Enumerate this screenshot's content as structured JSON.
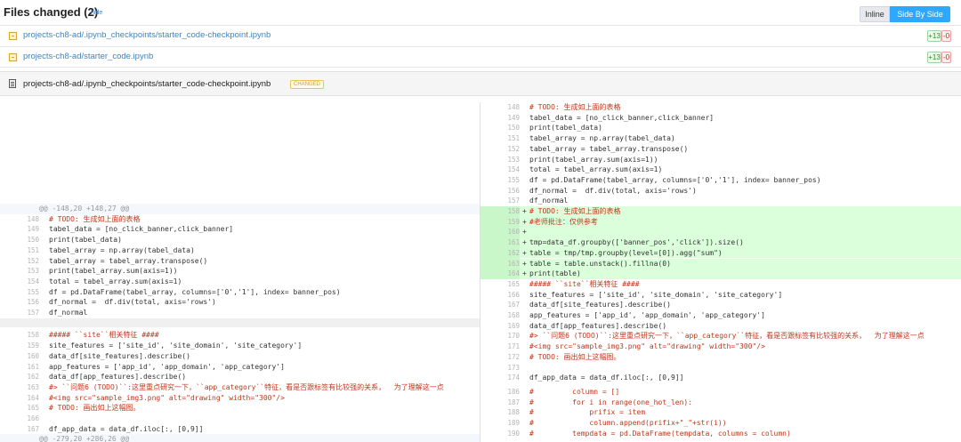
{
  "header": {
    "title": "Files changed (2)",
    "hide": "hide",
    "view_inline": "Inline",
    "view_side_by_side": "Side By Side"
  },
  "files": [
    {
      "path": "projects-ch8-ad/.ipynb_checkpoints/starter_code-checkpoint.ipynb",
      "additions": "+13",
      "deletions": "-0"
    },
    {
      "path": "projects-ch8-ad/starter_code.ipynb",
      "additions": "+13",
      "deletions": "-0"
    }
  ],
  "file_view": {
    "path": "projects-ch8-ad/.ipynb_checkpoints/starter_code-checkpoint.ipynb",
    "badge": "CHANGED",
    "colors": {
      "added_bg": "#dbffdb",
      "accent": "#2ea8ff",
      "link": "#4183c4"
    }
  },
  "left": {
    "hunk1": "@@ -148,20 +148,27 @@",
    "hunk2": "@@ -279,20 +286,26 @@",
    "lines_a": [
      {
        "n": "148",
        "t": "# TODO: 生成如上面的表格"
      },
      {
        "n": "149",
        "t": "tabel_data = [no_click_banner,click_banner]"
      },
      {
        "n": "150",
        "t": "print(tabel_data)"
      },
      {
        "n": "151",
        "t": "tabel_array = np.array(tabel_data)"
      },
      {
        "n": "152",
        "t": "tabel_array = tabel_array.transpose()"
      },
      {
        "n": "153",
        "t": "print(tabel_array.sum(axis=1))"
      },
      {
        "n": "154",
        "t": "total = tabel_array.sum(axis=1)"
      },
      {
        "n": "155",
        "t": "df = pd.DataFrame(tabel_array, columns=['0','1'], index= banner_pos)"
      },
      {
        "n": "156",
        "t": "df_normal =  df.div(total, axis='rows')"
      },
      {
        "n": "157",
        "t": "df_normal"
      }
    ],
    "lines_b": [
      {
        "n": "158",
        "t": "##### ``site``相关特征 ####"
      },
      {
        "n": "159",
        "t": "site_features = ['site_id', 'site_domain', 'site_category']"
      },
      {
        "n": "160",
        "t": "data_df[site_features].describe()"
      },
      {
        "n": "161",
        "t": "app_features = ['app_id', 'app_domain', 'app_category']"
      },
      {
        "n": "162",
        "t": "data_df[app_features].describe()"
      },
      {
        "n": "163",
        "t": "#> ``问题6 (TODO)``:这里重点研究一下，``app_category``特征，看是否跟标签有比较强的关系，  为了理解这一点"
      },
      {
        "n": "164",
        "t": "#<img src=\"sample_img3.png\" alt=\"drawing\" width=\"300\"/>"
      },
      {
        "n": "165",
        "t": "# TODO: 画出如上这幅图。"
      },
      {
        "n": "166",
        "t": ""
      },
      {
        "n": "167",
        "t": "df_app_data = data_df.iloc[:, [0,9]]"
      }
    ]
  },
  "right": {
    "lines": [
      {
        "n": "148",
        "t": "# TODO: 生成如上面的表格",
        "m": ""
      },
      {
        "n": "149",
        "t": "tabel_data = [no_click_banner,click_banner]",
        "m": ""
      },
      {
        "n": "150",
        "t": "print(tabel_data)",
        "m": ""
      },
      {
        "n": "151",
        "t": "tabel_array = np.array(tabel_data)",
        "m": ""
      },
      {
        "n": "152",
        "t": "tabel_array = tabel_array.transpose()",
        "m": ""
      },
      {
        "n": "153",
        "t": "print(tabel_array.sum(axis=1))",
        "m": ""
      },
      {
        "n": "154",
        "t": "total = tabel_array.sum(axis=1)",
        "m": ""
      },
      {
        "n": "155",
        "t": "df = pd.DataFrame(tabel_array, columns=['0','1'], index= banner_pos)",
        "m": ""
      },
      {
        "n": "156",
        "t": "df_normal =  df.div(total, axis='rows')",
        "m": ""
      },
      {
        "n": "157",
        "t": "df_normal",
        "m": ""
      },
      {
        "n": "158",
        "t": "# TODO: 生成如上面的表格",
        "m": "+"
      },
      {
        "n": "159",
        "t": "#老师批注：仅供参考",
        "m": "+"
      },
      {
        "n": "160",
        "t": "",
        "m": "+"
      },
      {
        "n": "161",
        "t": "tmp=data_df.groupby(['banner_pos','click']).size()",
        "m": "+"
      },
      {
        "n": "162",
        "t": "table = tmp/tmp.groupby(level=[0]).agg(\"sum\")",
        "m": "+"
      },
      {
        "n": "163",
        "t": "table = table.unstack().fillna(0)",
        "m": "+"
      },
      {
        "n": "164",
        "t": "print(table)",
        "m": "+"
      },
      {
        "n": "165",
        "t": "##### ``site``相关特征 ####",
        "m": ""
      },
      {
        "n": "166",
        "t": "site_features = ['site_id', 'site_domain', 'site_category']",
        "m": ""
      },
      {
        "n": "167",
        "t": "data_df[site_features].describe()",
        "m": ""
      },
      {
        "n": "168",
        "t": "app_features = ['app_id', 'app_domain', 'app_category']",
        "m": ""
      },
      {
        "n": "169",
        "t": "data_df[app_features].describe()",
        "m": ""
      },
      {
        "n": "170",
        "t": "#> ``问题6 (TODO)``:这里重点研究一下，``app_category``特征，看是否跟标签有比较强的关系，  为了理解这一点",
        "m": ""
      },
      {
        "n": "171",
        "t": "#<img src=\"sample_img3.png\" alt=\"drawing\" width=\"300\"/>",
        "m": ""
      },
      {
        "n": "172",
        "t": "# TODO: 画出如上这幅图。",
        "m": ""
      },
      {
        "n": "173",
        "t": "",
        "m": ""
      },
      {
        "n": "174",
        "t": "df_app_data = data_df.iloc[:, [0,9]]",
        "m": ""
      },
      {
        "n": "186",
        "t": "#         column = []",
        "m": ""
      },
      {
        "n": "187",
        "t": "#         for i in range(one_hot_len):",
        "m": ""
      },
      {
        "n": "188",
        "t": "#             prifix = item",
        "m": ""
      },
      {
        "n": "189",
        "t": "#             column.append(prifix+\"_\"+str(i))",
        "m": ""
      },
      {
        "n": "190",
        "t": "#         tempdata = pd.DataFrame(tempdata, columns = column)",
        "m": ""
      }
    ]
  }
}
